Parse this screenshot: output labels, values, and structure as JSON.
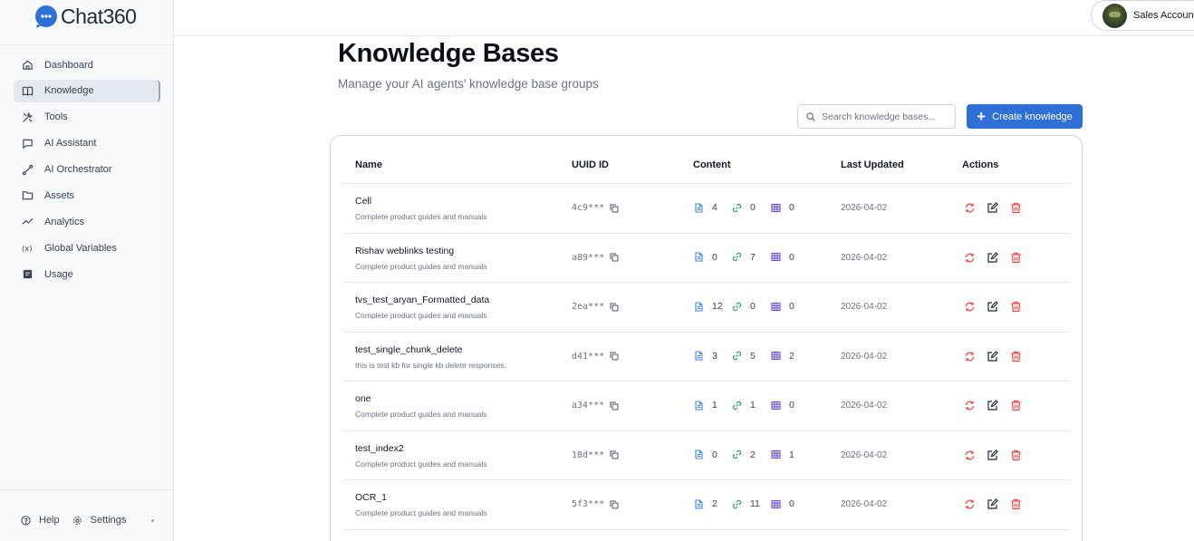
{
  "app": {
    "logo_text": "Chat360"
  },
  "sidebar": {
    "items": [
      {
        "label": "Dashboard",
        "icon": "home-icon"
      },
      {
        "label": "Knowledge",
        "icon": "book-icon",
        "active": true
      },
      {
        "label": "Tools",
        "icon": "tools-icon"
      },
      {
        "label": "AI Assistant",
        "icon": "chat-icon"
      },
      {
        "label": "AI Orchestrator",
        "icon": "route-icon"
      },
      {
        "label": "Assets",
        "icon": "folder-icon"
      },
      {
        "label": "Analytics",
        "icon": "trend-icon"
      },
      {
        "label": "Global Variables",
        "icon": "variable-icon"
      },
      {
        "label": "Usage",
        "icon": "usage-icon"
      }
    ],
    "footer": {
      "help": "Help",
      "settings": "Settings"
    }
  },
  "header": {
    "account_name": "Sales Account"
  },
  "page": {
    "title": "Knowledge Bases",
    "subtitle": "Manage your AI agents' knowledge base groups",
    "search_placeholder": "Search knowledge bases...",
    "create_label": "Create knowledge"
  },
  "table": {
    "columns": [
      "Name",
      "UUID ID",
      "Content",
      "Last Updated",
      "Actions"
    ],
    "rows": [
      {
        "name": "Cell",
        "desc": "Complete product guides and manuals",
        "uuid": "4c9***",
        "docs": "4",
        "links": "0",
        "tables": "0",
        "updated": "2026-04-02"
      },
      {
        "name": "Rishav weblinks testing",
        "desc": "Complete product guides and manuals",
        "uuid": "a89***",
        "docs": "0",
        "links": "7",
        "tables": "0",
        "updated": "2026-04-02"
      },
      {
        "name": "tvs_test_aryan_Formatted_data",
        "desc": "Complete product guides and manuals",
        "uuid": "2ea***",
        "docs": "12",
        "links": "0",
        "tables": "0",
        "updated": "2026-04-02"
      },
      {
        "name": "test_single_chunk_delete",
        "desc": "this is test kb for single kb delete responses.",
        "uuid": "d41***",
        "docs": "3",
        "links": "5",
        "tables": "2",
        "updated": "2026-04-02"
      },
      {
        "name": "one",
        "desc": "Complete product guides and manuals",
        "uuid": "a34***",
        "docs": "1",
        "links": "1",
        "tables": "0",
        "updated": "2026-04-02"
      },
      {
        "name": "test_index2",
        "desc": "Complete product guides and manuals",
        "uuid": "18d***",
        "docs": "0",
        "links": "2",
        "tables": "1",
        "updated": "2026-04-02"
      },
      {
        "name": "OCR_1",
        "desc": "Complete product guides and manuals",
        "uuid": "5f3***",
        "docs": "2",
        "links": "11",
        "tables": "0",
        "updated": "2026-04-02"
      }
    ]
  },
  "colors": {
    "accent": "#2f6fd8",
    "doc": "#3b82f6",
    "link": "#22a55a",
    "table": "#6d4fd8",
    "refresh": "#ef4444",
    "delete": "#ef4444"
  }
}
